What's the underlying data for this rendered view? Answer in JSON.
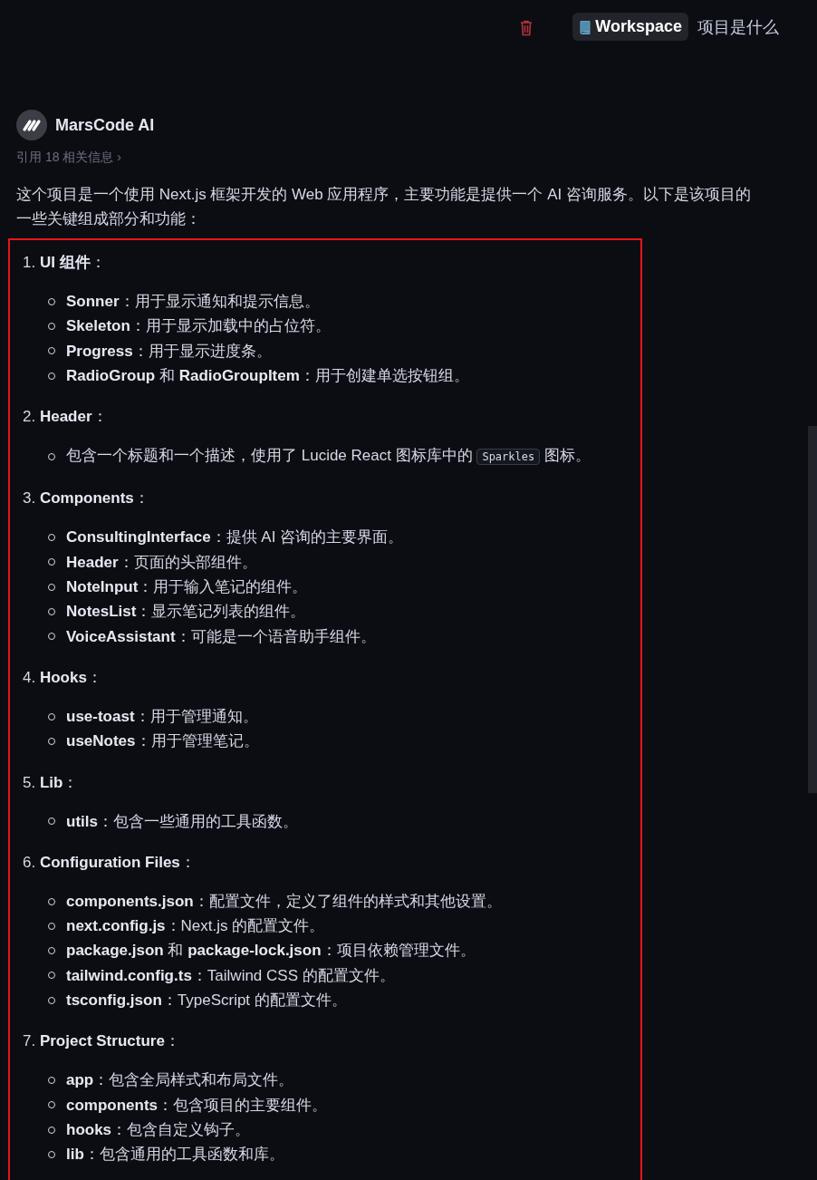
{
  "top_bar": {
    "workspace_tag": "Workspace",
    "question": "项目是什么"
  },
  "message": {
    "author": "MarsCode AI",
    "references": "引用 18 相关信息 ›",
    "intro": "这个项目是一个使用 Next.js 框架开发的 Web 应用程序，主要功能是提供一个 AI 咨询服务。以下是该项目的一些关键组成部分和功能：",
    "sections": [
      {
        "heading": "1. **UI 组件**：",
        "items": [
          [
            {
              "kind": "text",
              "text": "**Sonner**：用于显示通知和提示信息。"
            }
          ],
          [
            {
              "kind": "text",
              "text": "**Skeleton**：用于显示加载中的占位符。"
            }
          ],
          [
            {
              "kind": "text",
              "text": "**Progress**：用于显示进度条。"
            }
          ],
          [
            {
              "kind": "text",
              "text": "**RadioGroup** 和 **RadioGroupItem**：用于创建单选按钮组。"
            }
          ]
        ]
      },
      {
        "heading": "2. **Header**：",
        "items": [
          [
            {
              "kind": "text",
              "text": "包含一个标题和一个描述，使用了 Lucide React 图标库中的 "
            },
            {
              "kind": "code",
              "text": "Sparkles"
            },
            {
              "kind": "text",
              "text": " 图标。"
            }
          ]
        ]
      },
      {
        "heading": "3. **Components**：",
        "items": [
          [
            {
              "kind": "text",
              "text": "**ConsultingInterface**：提供 AI 咨询的主要界面。"
            }
          ],
          [
            {
              "kind": "text",
              "text": "**Header**：页面的头部组件。"
            }
          ],
          [
            {
              "kind": "text",
              "text": "**NoteInput**：用于输入笔记的组件。"
            }
          ],
          [
            {
              "kind": "text",
              "text": "**NotesList**：显示笔记列表的组件。"
            }
          ],
          [
            {
              "kind": "text",
              "text": "**VoiceAssistant**：可能是一个语音助手组件。"
            }
          ]
        ]
      },
      {
        "heading": "4. **Hooks**：",
        "items": [
          [
            {
              "kind": "text",
              "text": "**use-toast**：用于管理通知。"
            }
          ],
          [
            {
              "kind": "text",
              "text": "**useNotes**：用于管理笔记。"
            }
          ]
        ]
      },
      {
        "heading": "5. **Lib**：",
        "items": [
          [
            {
              "kind": "text",
              "text": "**utils**：包含一些通用的工具函数。"
            }
          ]
        ]
      },
      {
        "heading": "6. **Configuration Files**：",
        "items": [
          [
            {
              "kind": "text",
              "text": "**components.json**：配置文件，定义了组件的样式和其他设置。"
            }
          ],
          [
            {
              "kind": "text",
              "text": "**next.config.js**：Next.js 的配置文件。"
            }
          ],
          [
            {
              "kind": "text",
              "text": "**package.json** 和 **package-lock.json**：项目依赖管理文件。"
            }
          ],
          [
            {
              "kind": "text",
              "text": "**tailwind.config.ts**：Tailwind CSS 的配置文件。"
            }
          ],
          [
            {
              "kind": "text",
              "text": "**tsconfig.json**：TypeScript 的配置文件。"
            }
          ]
        ]
      },
      {
        "heading": "7. **Project Structure**：",
        "items": [
          [
            {
              "kind": "text",
              "text": "**app**：包含全局样式和布局文件。"
            }
          ],
          [
            {
              "kind": "text",
              "text": "**components**：包含项目的主要组件。"
            }
          ],
          [
            {
              "kind": "text",
              "text": "**hooks**：包含自定义钩子。"
            }
          ],
          [
            {
              "kind": "text",
              "text": "**lib**：包含通用的工具函数和库。"
            }
          ]
        ]
      }
    ]
  }
}
